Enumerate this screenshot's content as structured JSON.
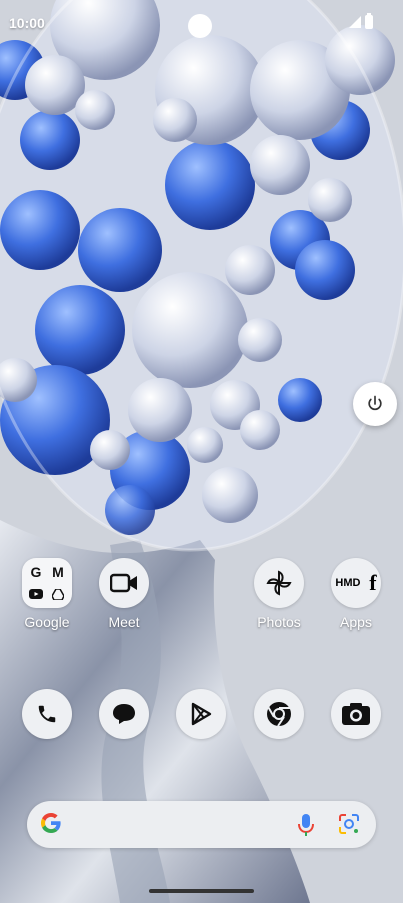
{
  "status_bar": {
    "time": "10:00"
  },
  "home": {
    "row1": [
      {
        "label": "Google"
      },
      {
        "label": "Meet"
      },
      {
        "label": "Photos"
      },
      {
        "label": "Apps"
      }
    ],
    "folder_apps_text": {
      "hmd": "HMD"
    },
    "dock": [
      {
        "name": "Phone"
      },
      {
        "name": "Messages"
      },
      {
        "name": "Play Store"
      },
      {
        "name": "Chrome"
      },
      {
        "name": "Camera"
      }
    ]
  },
  "colors": {
    "primary": "#4285F4",
    "accent_blue": "#3f6fe0",
    "icon_bg": "#eef0f3"
  }
}
